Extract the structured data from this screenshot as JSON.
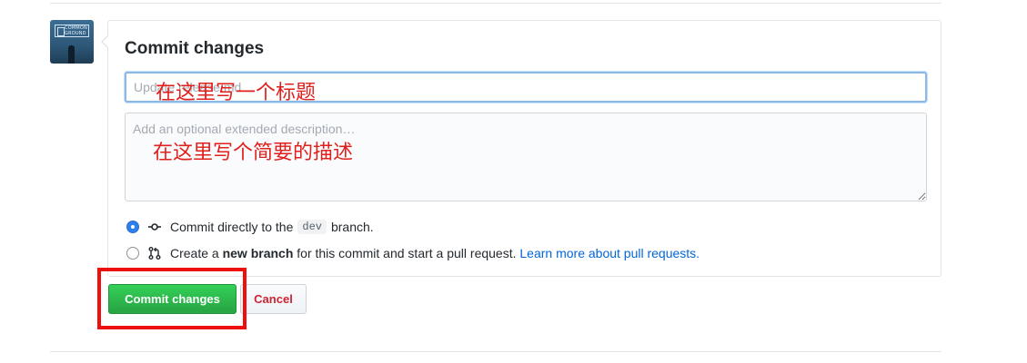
{
  "commit_form": {
    "title": "Commit changes",
    "summary_placeholder": "Update release.md",
    "summary_annotation": "在这里写一个标题",
    "description_placeholder": "Add an optional extended description…",
    "description_annotation": "在这里写个简要的描述",
    "option_direct": {
      "text_before": "Commit directly to the",
      "branch_name": "dev",
      "text_after": "branch.",
      "selected": true
    },
    "option_new_branch": {
      "text_before": "Create a ",
      "bold_text": "new branch",
      "text_after": " for this commit and start a pull request.",
      "link_text": "Learn more about pull requests.",
      "selected": false
    },
    "commit_button_label": "Commit changes",
    "cancel_button_label": "Cancel"
  },
  "avatar": {
    "sign_text": "COMMON GROUND"
  },
  "icons": {
    "direct": "git-commit-icon",
    "new_branch": "git-pull-request-icon"
  },
  "colors": {
    "commit_button": "#2cbe4e",
    "cancel_text": "#cb2431",
    "link": "#0366d6",
    "annotation": "#e0201d",
    "highlight_box": "#ee0f0f"
  }
}
